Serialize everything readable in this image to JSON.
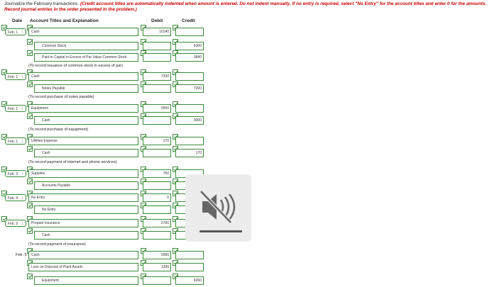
{
  "instructions": {
    "lead": "Journalize the February transactions.",
    "note": "(Credit account titles are automatically indented when amount is entered. Do not indent manually. If no entry is required, select \"No Entry\" for the account titles and enter 0 for the amounts. Record journal entries in the order presented in the problem.)"
  },
  "headers": {
    "date": "Date",
    "account": "Account Titles and Explanation",
    "debit": "Debit",
    "credit": "Credit"
  },
  "entries": [
    {
      "date": "Feb. 1",
      "lines": [
        {
          "account": "Cash",
          "debit": "10140",
          "credit": ""
        },
        {
          "account": "Common Stock",
          "debit": "",
          "credit": "6300"
        },
        {
          "account": "Paid-in Capital in Excess of Par Value-Common Stock",
          "debit": "",
          "credit": "3840"
        }
      ],
      "note": "(To record issuance of common stock in excess of par)"
    },
    {
      "date": "Feb. 1",
      "lines": [
        {
          "account": "Cash",
          "debit": "7200",
          "credit": ""
        },
        {
          "account": "Notes Payable",
          "debit": "",
          "credit": "7200"
        }
      ],
      "note": "(To record purchase of notes payable)"
    },
    {
      "date": "Feb. 1",
      "lines": [
        {
          "account": "Equipment",
          "debit": "9000",
          "credit": ""
        },
        {
          "account": "Cash",
          "debit": "",
          "credit": "9000"
        }
      ],
      "note": "(To record purchase of equipment)"
    },
    {
      "date": "Feb. 1",
      "lines": [
        {
          "account": "Utilities Expense",
          "debit": "170",
          "credit": ""
        },
        {
          "account": "Cash",
          "debit": "",
          "credit": "170"
        }
      ],
      "note": "(To record payment of internet and phone services)"
    },
    {
      "date": "Feb. 3",
      "lines": [
        {
          "account": "Supplies",
          "debit": "760",
          "credit": ""
        },
        {
          "account": "Accounts Payable",
          "debit": "",
          "credit": ""
        }
      ],
      "note": ""
    },
    {
      "date": "Feb. 4",
      "lines": [
        {
          "account": "No Entry",
          "debit": "0",
          "credit": ""
        },
        {
          "account": "No Entry",
          "debit": "",
          "credit": ""
        }
      ],
      "note": ""
    },
    {
      "date": "Feb. 5",
      "lines": [
        {
          "account": "Prepaid Insurance",
          "debit": "2760",
          "credit": ""
        },
        {
          "account": "Cash",
          "debit": "",
          "credit": ""
        }
      ],
      "note": "(To record payment of insurance)"
    },
    {
      "date": "Feb. 5",
      "lines": [
        {
          "account": "Cash",
          "debit": "3080",
          "credit": ""
        },
        {
          "account": "Loss on Disposal of Plant Assets",
          "debit": "1280",
          "credit": ""
        },
        {
          "account": "Equipment",
          "debit": "",
          "credit": "4360"
        }
      ],
      "note": ""
    }
  ],
  "icons": {
    "check": "check-icon",
    "speaker": "speaker-muted-icon"
  }
}
